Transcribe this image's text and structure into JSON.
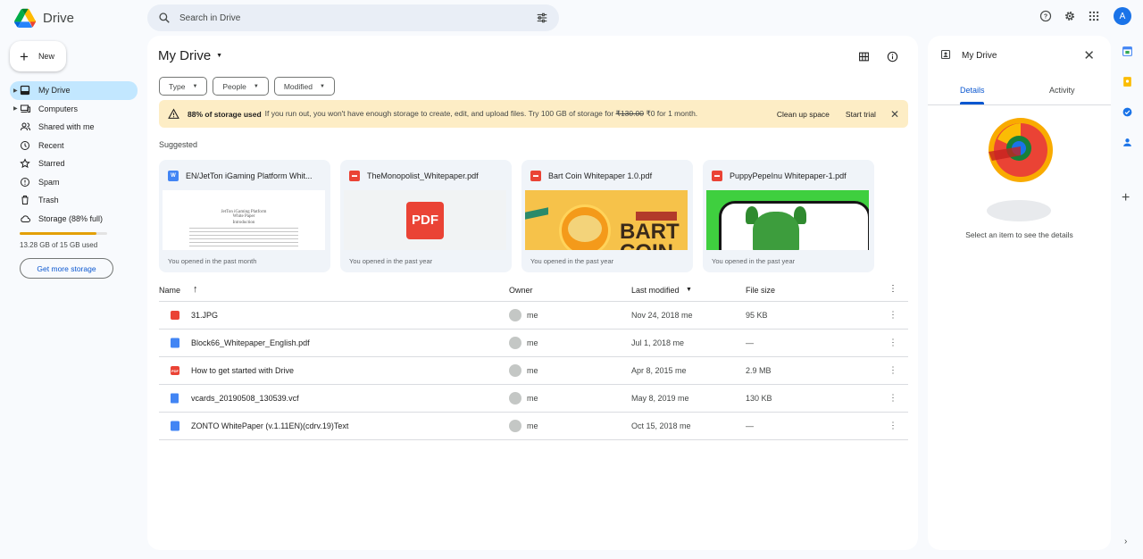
{
  "app": {
    "name": "Drive"
  },
  "search": {
    "placeholder": "Search in Drive"
  },
  "header": {
    "avatar_initial": "A"
  },
  "sidebar": {
    "new_label": "New",
    "items": [
      {
        "label": "My Drive",
        "icon": "my-drive-icon",
        "active": true
      },
      {
        "label": "Computers",
        "icon": "computer-icon"
      },
      {
        "label": "Shared with me",
        "icon": "people-icon"
      },
      {
        "label": "Recent",
        "icon": "clock-icon"
      },
      {
        "label": "Starred",
        "icon": "star-icon"
      },
      {
        "label": "Spam",
        "icon": "spam-icon"
      },
      {
        "label": "Trash",
        "icon": "trash-icon"
      },
      {
        "label": "Storage (88% full)",
        "icon": "cloud-icon"
      }
    ],
    "storage_used_fraction": 0.88,
    "storage_text": "13.28 GB of 15 GB used",
    "get_storage_label": "Get more storage"
  },
  "main": {
    "title": "My Drive",
    "filters": [
      "Type",
      "People",
      "Modified"
    ],
    "banner": {
      "bold": "88% of storage used",
      "msg_before": "If you run out, you won't have enough storage to create, edit, and upload files. Try 100 GB of storage for ",
      "old_price": "₹130.00",
      "msg_after": " ₹0 for 1 month.",
      "action1": "Clean up space",
      "action2": "Start trial"
    },
    "suggested_label": "Suggested",
    "cards": [
      {
        "name": "EN/JetTon iGaming Platform Whit...",
        "type": "word",
        "foot": "You opened in the past month",
        "thumb_title": "JetTon iGaming Platform",
        "thumb_sub": "White Paper",
        "thumb_caption": "Introduction"
      },
      {
        "name": "TheMonopolist_Whitepaper.pdf",
        "type": "pdf",
        "foot": "You opened in the past year",
        "pdf_badge": "PDF"
      },
      {
        "name": "Bart Coin Whitepaper 1.0.pdf",
        "type": "pdf",
        "foot": "You opened in the past year",
        "thumb_text": "BART COIN"
      },
      {
        "name": "PuppyPepeInu Whitepaper-1.pdf",
        "type": "pdf",
        "foot": "You opened in the past year"
      }
    ],
    "columns": {
      "name": "Name",
      "owner": "Owner",
      "modified": "Last modified",
      "size": "File size"
    },
    "rows": [
      {
        "name": "31.JPG",
        "type": "image",
        "owner": "me",
        "modified": "Nov 24, 2018 me",
        "size": "95 KB"
      },
      {
        "name": "Block66_Whitepaper_English.pdf",
        "type": "doc",
        "owner": "me",
        "modified": "Jul 1, 2018 me",
        "size": "—"
      },
      {
        "name": "How to get started with Drive",
        "type": "pdf",
        "owner": "me",
        "modified": "Apr 8, 2015 me",
        "size": "2.9 MB"
      },
      {
        "name": "vcards_20190508_130539.vcf",
        "type": "file",
        "owner": "me",
        "modified": "May 8, 2019 me",
        "size": "130 KB"
      },
      {
        "name": "ZONTO WhitePaper (v.1.11EN)(cdrv.19)Text",
        "type": "doc",
        "owner": "me",
        "modified": "Oct 15, 2018 me",
        "size": "—"
      }
    ]
  },
  "details": {
    "title": "My Drive",
    "tabs": [
      "Details",
      "Activity"
    ],
    "empty_msg": "Select an item to see the details"
  },
  "colors": {
    "accent": "#0b57d0",
    "active_nav": "#c2e7ff",
    "banner": "#fdedc5",
    "storage": "#e3a008"
  }
}
